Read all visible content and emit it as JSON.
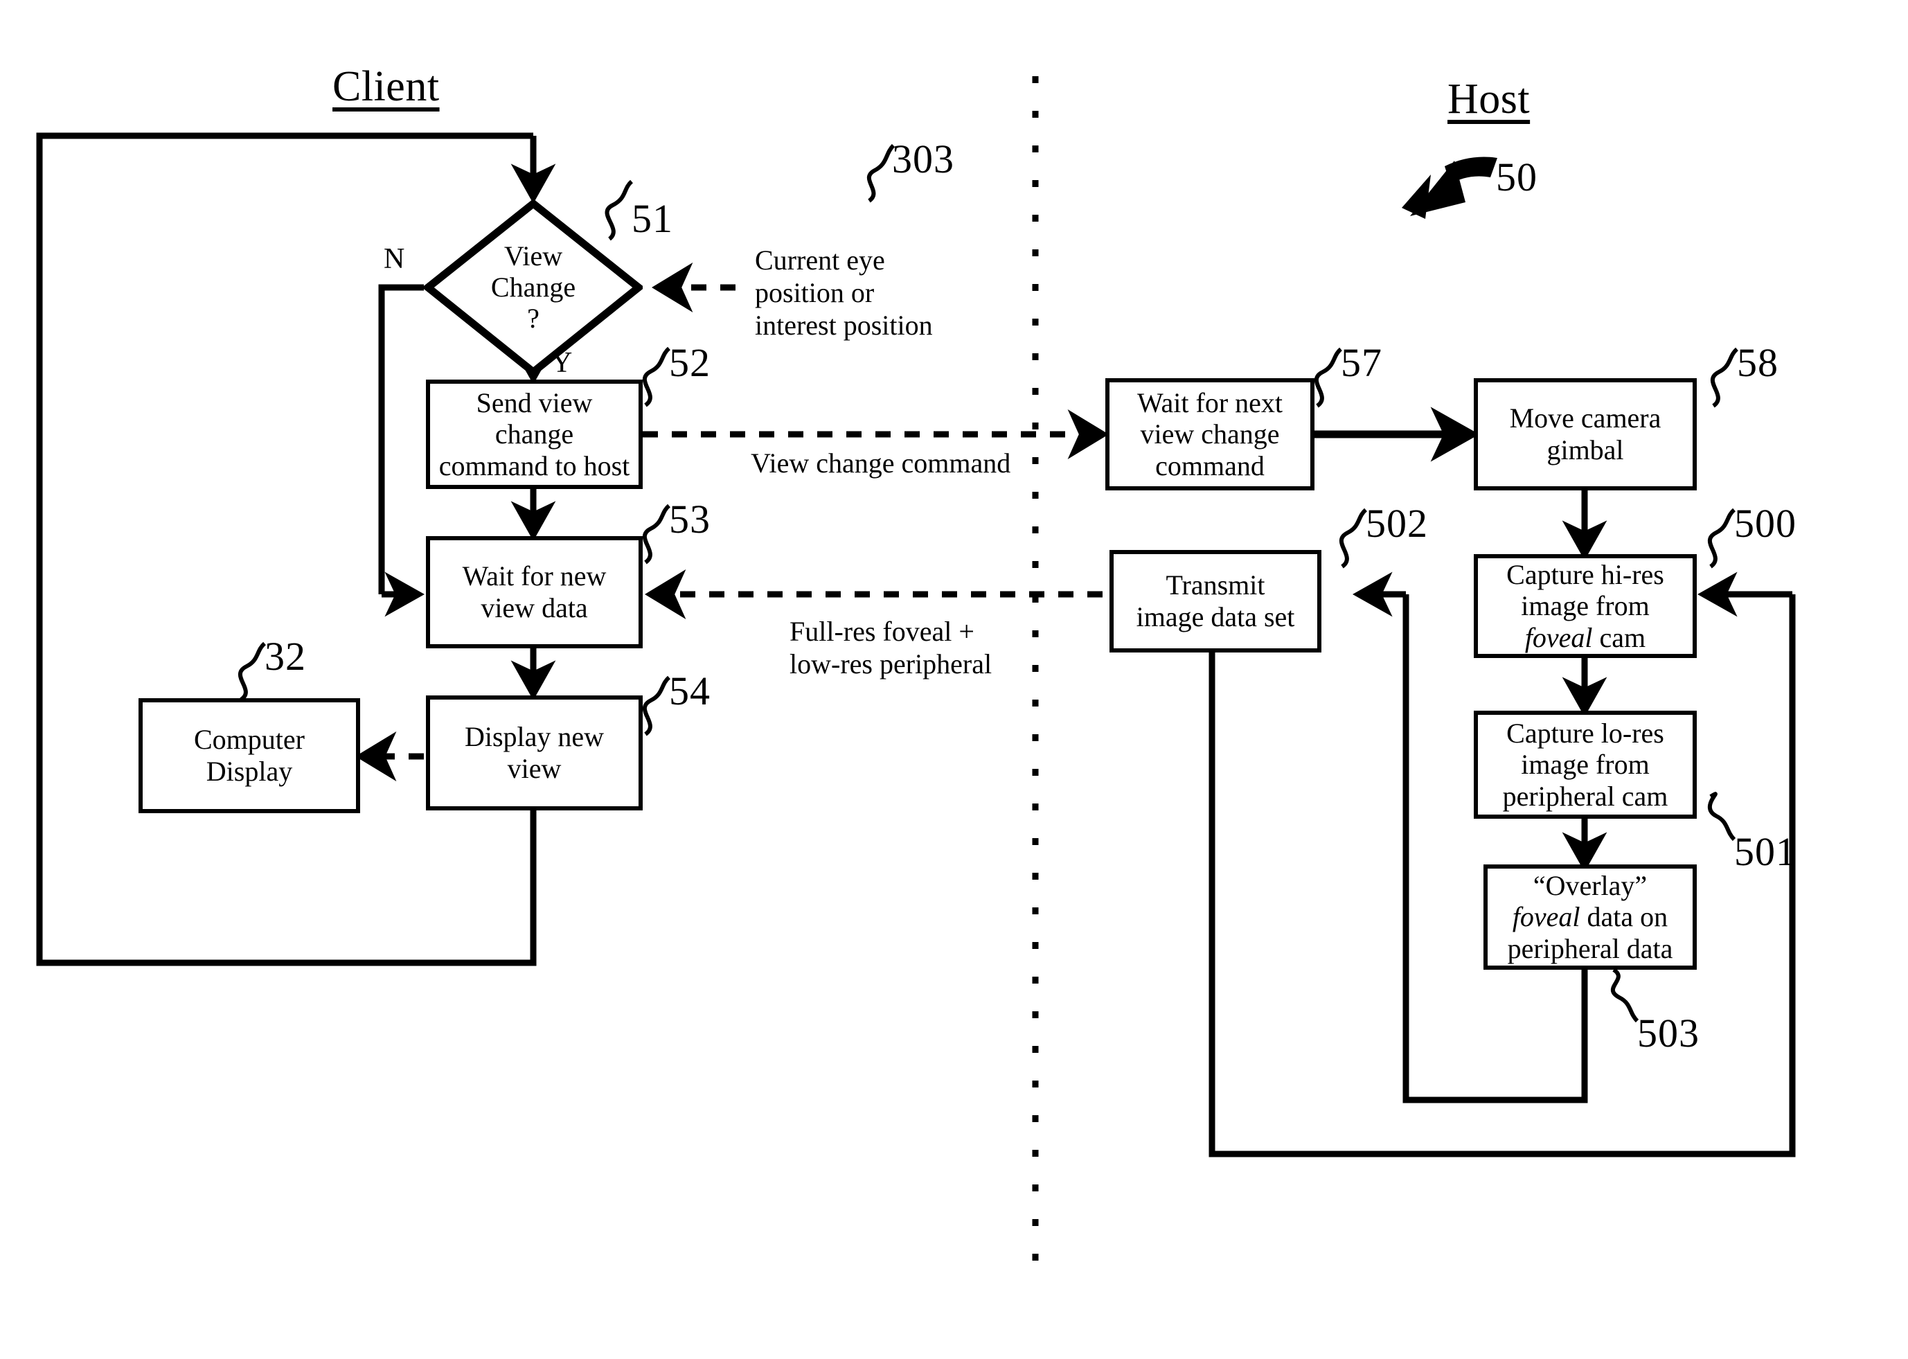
{
  "figure": {
    "reference_numeral": "50",
    "columns": {
      "client_title": "Client",
      "host_title": "Host"
    }
  },
  "client": {
    "decision": {
      "ref": "51",
      "text": "View\nChange\n?",
      "yes_label": "Y",
      "no_label": "N"
    },
    "boxes": [
      {
        "ref": "52",
        "text": "Send view\nchange\ncommand to host"
      },
      {
        "ref": "53",
        "text": "Wait for new\nview data"
      },
      {
        "ref": "54",
        "text": "Display new\nview"
      },
      {
        "ref": "32",
        "text": "Computer\nDisplay"
      }
    ],
    "annotation": {
      "ref": "303",
      "text": "Current eye\nposition or\ninterest position"
    }
  },
  "host": {
    "boxes": [
      {
        "ref": "57",
        "text": "Wait for next\nview change\ncommand"
      },
      {
        "ref": "58",
        "text": "Move camera\ngimbal"
      },
      {
        "ref": "500",
        "text_plain_1": "Capture hi-res",
        "text_plain_2": "image from",
        "text_italic": "foveal",
        "text_plain_3": " cam"
      },
      {
        "ref": "501",
        "text": "Capture lo-res\nimage from\nperipheral cam"
      },
      {
        "ref": "503",
        "text_plain_1": "“Overlay”",
        "text_italic": "foveal",
        "text_plain_2": " data on",
        "text_plain_3": "peripheral data"
      },
      {
        "ref": "502",
        "text": "Transmit\nimage data set"
      }
    ]
  },
  "link_labels": {
    "view_change_command": "View change command",
    "image_data": "Full-res foveal +\nlow-res peripheral"
  },
  "colors": {
    "ink": "#000000",
    "paper": "#ffffff"
  }
}
